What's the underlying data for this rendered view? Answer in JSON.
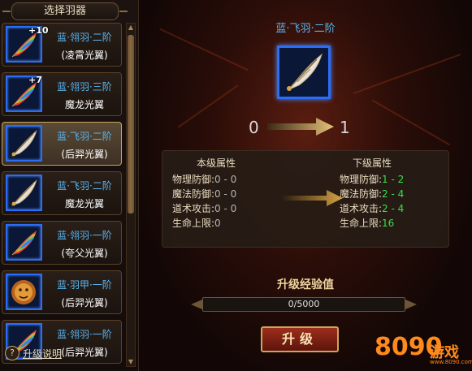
{
  "left_panel": {
    "title": "选择羽器"
  },
  "items": [
    {
      "plus": "+10",
      "name": "蓝·翎羽·二阶",
      "sub": "(凌霄光翼)",
      "selected": false,
      "icon": "rainbow-feather-icon"
    },
    {
      "plus": "+7",
      "name": "蓝·翎羽·三阶",
      "sub": "魔龙光翼",
      "selected": false,
      "icon": "rainbow-feather-icon"
    },
    {
      "plus": "",
      "name": "蓝·飞羽·二阶",
      "sub": "(后羿光翼)",
      "selected": true,
      "icon": "silver-feather-icon"
    },
    {
      "plus": "",
      "name": "蓝·飞羽·二阶",
      "sub": "魔龙光翼",
      "selected": false,
      "icon": "silver-feather-icon"
    },
    {
      "plus": "",
      "name": "蓝·翎羽·一阶",
      "sub": "(夸父光翼)",
      "selected": false,
      "icon": "rainbow-feather-icon"
    },
    {
      "plus": "",
      "name": "蓝·羽甲·一阶",
      "sub": "(后羿光翼)",
      "selected": false,
      "icon": "lion-armor-icon"
    },
    {
      "plus": "",
      "name": "蓝·翎羽·一阶",
      "sub": "(后羿光翼)",
      "selected": false,
      "icon": "rainbow-feather-icon"
    }
  ],
  "detail": {
    "title": "蓝·飞羽·二阶",
    "level_from": "0",
    "level_to": "1",
    "current_header": "本级属性",
    "next_header": "下级属性",
    "current_attrs": [
      {
        "key": "物理防御:",
        "val": "0 - 0"
      },
      {
        "key": "魔法防御:",
        "val": "0 - 0"
      },
      {
        "key": "道术攻击:",
        "val": "0 - 0"
      },
      {
        "key": "生命上限:",
        "val": "0"
      }
    ],
    "next_attrs": [
      {
        "key": "物理防御:",
        "val": "1 - 2"
      },
      {
        "key": "魔法防御:",
        "val": "2 - 4"
      },
      {
        "key": "道术攻击:",
        "val": "2 - 4"
      },
      {
        "key": "生命上限:",
        "val": "16"
      }
    ]
  },
  "exp": {
    "title": "升级经验值",
    "text": "0/5000",
    "current": 0,
    "max": 5000
  },
  "upgrade_button": "升级",
  "help": {
    "icon": "question-icon",
    "text": "升级说明"
  },
  "watermark": {
    "digits": "8090",
    "text": "游戏",
    "sub": "www.8090.com"
  },
  "colors": {
    "blue_name": "#5ab6f2",
    "green_value": "#37e04b",
    "gold": "#c9a55d",
    "frame_blue": "#2b6df7"
  }
}
